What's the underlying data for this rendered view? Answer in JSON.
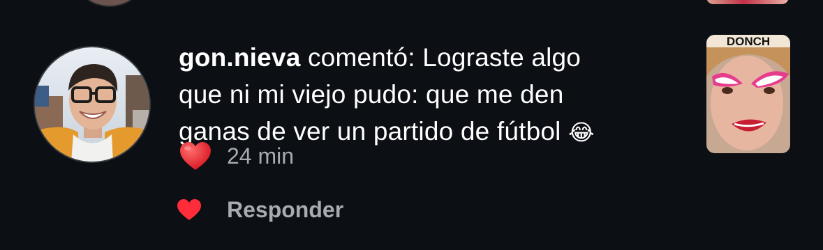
{
  "comment": {
    "username": "gon.nieva",
    "action": "comentó:",
    "text_line1": "Lograste algo",
    "text_line2": "que ni mi viejo pudo: que me den",
    "text_line3": "ganas de ver un partido de fútbol",
    "emoji": "😂",
    "reaction_emoji": "heart-emoji",
    "time": "24 min"
  },
  "thumbnail": {
    "caption": "DONCH"
  },
  "actions": {
    "like_icon": "heart-icon",
    "reply_label": "Responder"
  },
  "colors": {
    "background": "#0c0f14",
    "text": "#ffffff",
    "secondary": "#a8abb0",
    "heart": "#ff2d3a"
  }
}
